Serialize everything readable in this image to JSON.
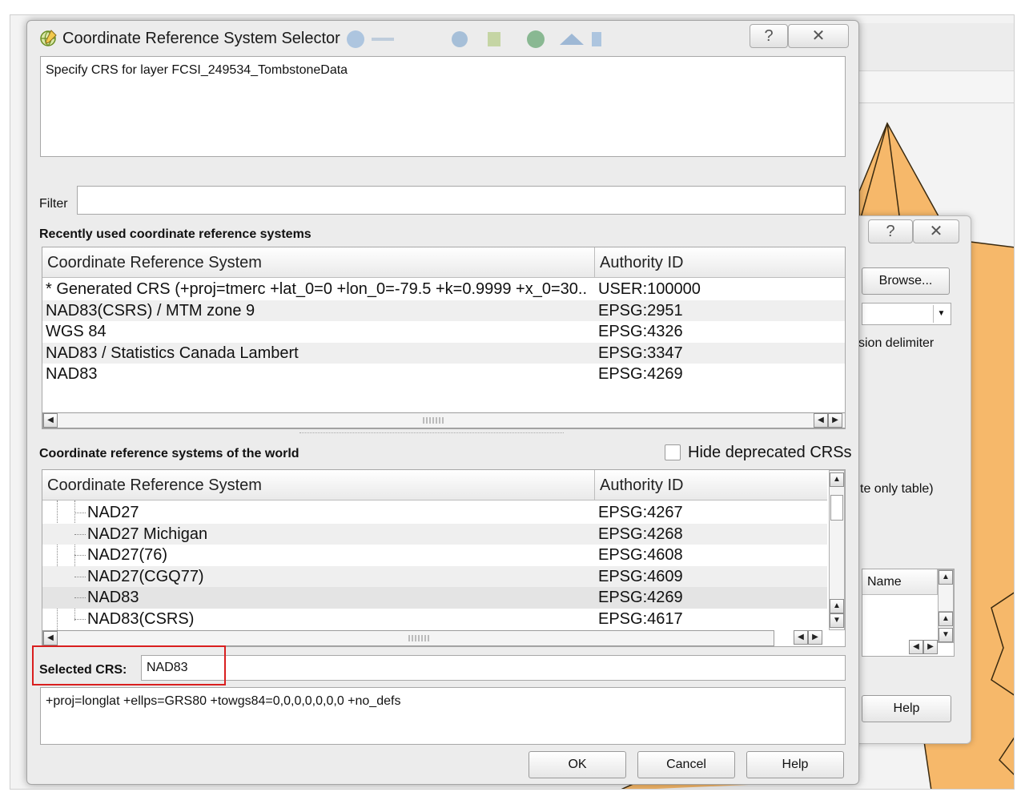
{
  "background": {
    "secondary_dialog": {
      "browse_label": "Browse...",
      "delimiter_label": "sion delimiter",
      "table_note": "te only table)",
      "name_header": "Name",
      "help_label": "Help"
    }
  },
  "dialog": {
    "title": "Coordinate Reference System Selector",
    "help_icon": "question-icon",
    "close_icon": "close-icon",
    "description": "Specify CRS for layer FCSI_249534_TombstoneData",
    "filter_label": "Filter",
    "filter_value": "",
    "recent_heading": "Recently used coordinate reference systems",
    "recent_columns": [
      "Coordinate Reference System",
      "Authority ID"
    ],
    "recent_rows": [
      {
        "crs": " * Generated CRS (+proj=tmerc +lat_0=0 +lon_0=-79.5 +k=0.9999 +x_0=30...",
        "id": "USER:100000"
      },
      {
        "crs": "NAD83(CSRS) / MTM zone 9",
        "id": "EPSG:2951"
      },
      {
        "crs": "WGS 84",
        "id": "EPSG:4326"
      },
      {
        "crs": "NAD83 / Statistics Canada Lambert",
        "id": "EPSG:3347"
      },
      {
        "crs": "NAD83",
        "id": "EPSG:4269"
      }
    ],
    "world_heading": "Coordinate reference systems of the world",
    "hide_deprecated_label": "Hide deprecated CRSs",
    "world_columns": [
      "Coordinate Reference System",
      "Authority ID"
    ],
    "world_rows": [
      {
        "crs": "NAD27",
        "id": "EPSG:4267"
      },
      {
        "crs": "NAD27 Michigan",
        "id": "EPSG:4268"
      },
      {
        "crs": "NAD27(76)",
        "id": "EPSG:4608"
      },
      {
        "crs": "NAD27(CGQ77)",
        "id": "EPSG:4609"
      },
      {
        "crs": "NAD83",
        "id": "EPSG:4269"
      },
      {
        "crs": "NAD83(CSRS)",
        "id": "EPSG:4617"
      }
    ],
    "selected_crs_label": "Selected CRS:",
    "selected_crs_value": "NAD83",
    "proj_string": "+proj=longlat +ellps=GRS80 +towgs84=0,0,0,0,0,0,0 +no_defs",
    "buttons": {
      "ok": "OK",
      "cancel": "Cancel",
      "help": "Help"
    }
  },
  "colors": {
    "highlight": "#d91f1f",
    "map_fill": "#f6b86a",
    "map_line": "#3a2a10"
  }
}
